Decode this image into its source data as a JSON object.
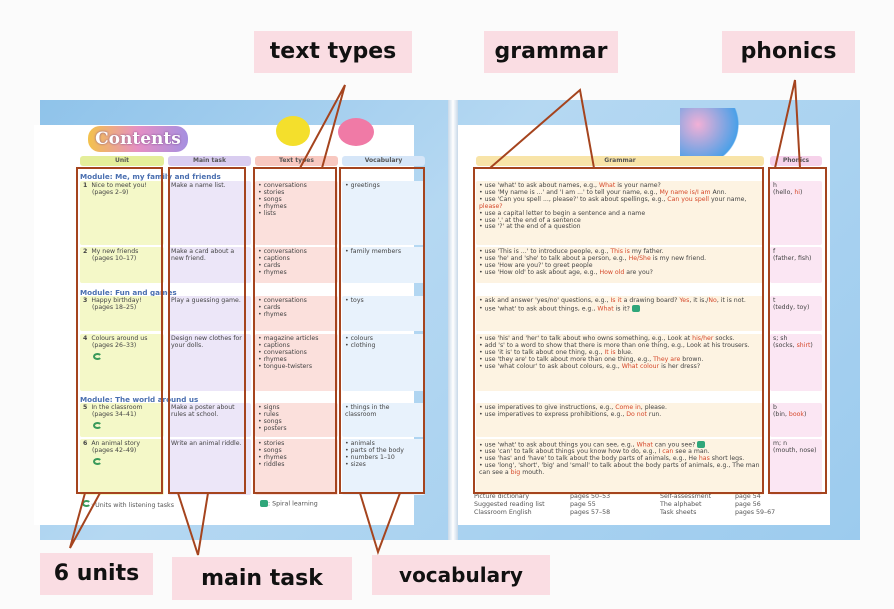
{
  "labels": {
    "text_types": "text types",
    "grammar": "grammar",
    "phonics": "phonics",
    "units": "6 units",
    "main_task": "main task",
    "vocabulary": "vocabulary"
  },
  "title": "Contents",
  "headers": {
    "unit": "Unit",
    "main_task": "Main task",
    "text_types": "Text types",
    "vocabulary": "Vocabulary",
    "grammar": "Grammar",
    "phonics": "Phonics"
  },
  "modules": [
    "Module: Me, my family and friends",
    "Module: Fun and games",
    "Module: The world around us"
  ],
  "units": [
    {
      "num": "1",
      "name": "Nice to meet you!",
      "pages": "(pages 2–9)",
      "listening": false,
      "task": "Make a name list.",
      "text_types": [
        "conversations",
        "stories",
        "songs",
        "rhymes",
        "lists"
      ],
      "vocabulary": [
        "greetings"
      ],
      "grammar": [
        [
          "use 'what' to ask about names, e.g., ",
          [
            "What"
          ],
          " is your name?"
        ],
        [
          "use 'My name is ...' and 'I am ...' to tell your name, e.g., ",
          [
            "My name is/I am"
          ],
          " Ann."
        ],
        [
          "use 'Can you spell ..., please?' to ask about spellings, e.g., ",
          [
            "Can you spell"
          ],
          " your name, ",
          [
            "please?"
          ]
        ],
        [
          "use a capital letter to begin a sentence and a name"
        ],
        [
          "use '.' at the end of a sentence"
        ],
        [
          "use '?' at the end of a question"
        ]
      ],
      "phonics": [
        "h",
        [
          "(hello, ",
          [
            "hi"
          ],
          ")"
        ]
      ]
    },
    {
      "num": "2",
      "name": "My new friends",
      "pages": "(pages 10–17)",
      "listening": false,
      "task": "Make a card about a new friend.",
      "text_types": [
        "conversations",
        "captions",
        "cards",
        "rhymes"
      ],
      "vocabulary": [
        "family members"
      ],
      "grammar": [
        [
          "use 'This is ...' to introduce people, e.g., ",
          [
            "This is"
          ],
          " my father."
        ],
        [
          "use 'he' and 'she' to talk about a person, e.g., ",
          [
            "He/She"
          ],
          " is my new friend."
        ],
        [
          "use 'How are you?' to greet people"
        ],
        [
          "use 'How old' to ask about age, e.g., ",
          [
            "How old"
          ],
          " are you?"
        ]
      ],
      "phonics": [
        "f",
        [
          "(father, fish)"
        ]
      ]
    },
    {
      "num": "3",
      "name": "Happy birthday!",
      "pages": "(pages 18–25)",
      "listening": false,
      "task": "Play a guessing game.",
      "text_types": [
        "conversations",
        "cards",
        "rhymes"
      ],
      "vocabulary": [
        "toys"
      ],
      "grammar": [
        [
          "ask and answer 'yes/no' questions, e.g., ",
          [
            "Is it"
          ],
          " a drawing board? ",
          [
            "Yes"
          ],
          ", it is./",
          [
            "No"
          ],
          ", it is not."
        ],
        [
          "use 'what' to ask about things, e.g., ",
          [
            "What"
          ],
          " is it?"
        ]
      ],
      "phonics": [
        "t",
        [
          "(teddy, toy)"
        ]
      ]
    },
    {
      "num": "4",
      "name": "Colours around us",
      "pages": "(pages 26–33)",
      "listening": true,
      "task": "Design new clothes for your dolls.",
      "text_types": [
        "magazine articles",
        "captions",
        "conversations",
        "rhymes",
        "tongue-twisters"
      ],
      "vocabulary": [
        "colours",
        "clothing"
      ],
      "grammar": [
        [
          "use 'his' and 'her' to talk about who owns something, e.g., Look at ",
          [
            "his/her"
          ],
          " socks."
        ],
        [
          "add 's' to a word to show that there is more than one thing, e.g., Look at his trousers."
        ],
        [
          "use 'it is' to talk about one thing, e.g., ",
          [
            "It is"
          ],
          " blue."
        ],
        [
          "use 'they are' to talk about more than one thing, e.g., ",
          [
            "They are"
          ],
          " brown."
        ],
        [
          "use 'what colour' to ask about colours, e.g., ",
          [
            "What colour"
          ],
          " is her dress?"
        ]
      ],
      "phonics": [
        "s; sh",
        [
          "(socks, ",
          [
            "shirt"
          ],
          ")"
        ]
      ]
    },
    {
      "num": "5",
      "name": "In the classroom",
      "pages": "(pages 34–41)",
      "listening": true,
      "task": "Make a poster about rules at school.",
      "text_types": [
        "signs",
        "rules",
        "songs",
        "posters"
      ],
      "vocabulary": [
        "things in the classroom"
      ],
      "grammar": [
        [
          "use imperatives to give instructions, e.g., ",
          [
            "Come in"
          ],
          ", please."
        ],
        [
          "use imperatives to express prohibitions, e.g., ",
          [
            "Do not"
          ],
          " run."
        ]
      ],
      "phonics": [
        "b",
        [
          "(bin, ",
          [
            "book"
          ],
          ")"
        ]
      ]
    },
    {
      "num": "6",
      "name": "An animal story",
      "pages": "(pages 42–49)",
      "listening": true,
      "task": "Write an animal riddle.",
      "text_types": [
        "stories",
        "songs",
        "rhymes",
        "riddles"
      ],
      "vocabulary": [
        "animals",
        "parts of the body",
        "numbers 1–10",
        "sizes"
      ],
      "grammar": [
        [
          "use 'what' to ask about things you can see, e.g., ",
          [
            "What"
          ],
          " can you see?"
        ],
        [
          "use 'can' to talk about things you know how to do, e.g., I ",
          [
            "can"
          ],
          " see a man."
        ],
        [
          "use 'has' and 'have' to talk about the body parts of animals, e.g., He ",
          [
            "has"
          ],
          " short legs."
        ],
        [
          "use 'long', 'short', 'big' and 'small' to talk about the body parts of animals, e.g., The man can see a ",
          [
            "big"
          ],
          " mouth."
        ]
      ],
      "phonics": [
        "m; n",
        [
          "(mouth, nose)"
        ]
      ]
    }
  ],
  "legend": {
    "listening": ": Units with listening tasks",
    "spiral": ": Spiral learning"
  },
  "extras": [
    [
      "Picture dictionary",
      "pages 50–53",
      "Self-assessment",
      "page 54"
    ],
    [
      "Suggested reading list",
      "page 55",
      "The alphabet",
      "page 56"
    ],
    [
      "Classroom English",
      "pages 57–58",
      "Task sheets",
      "pages 59–67"
    ]
  ],
  "colors": {
    "annotation_box": "#a5441e",
    "label_bg": "#fadde3",
    "highlight": "#d5482a",
    "module": "#4a6fb0"
  }
}
